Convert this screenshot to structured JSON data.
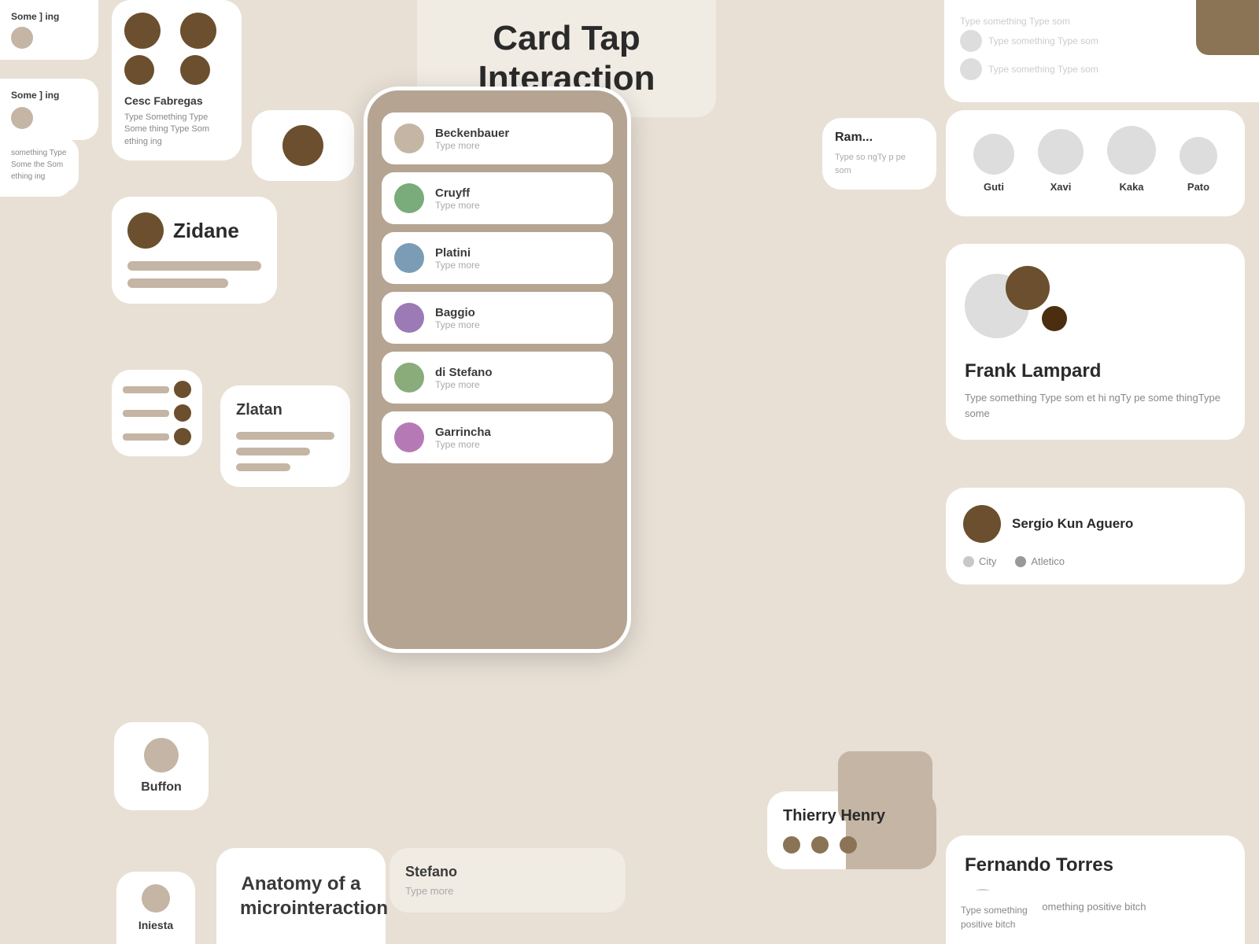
{
  "title": {
    "line1": "Card Tap",
    "line2": "Interaction"
  },
  "some_thing_1": "Some\n] ing",
  "some_thing_2": "Some\n] ing",
  "cesc": {
    "name": "Cesc Fabregas",
    "text": "Type Something Type Some thing Type Som ething ing"
  },
  "zidane": {
    "name": "Zidane"
  },
  "zlatan": {
    "name": "Zlatan"
  },
  "phone": {
    "players": [
      {
        "name": "Beckenbauer",
        "sub": "Type more",
        "color": "#c4b5a5"
      },
      {
        "name": "Cruyff",
        "sub": "Type more",
        "color": "#7aab7a"
      },
      {
        "name": "Platini",
        "sub": "Type more",
        "color": "#7a9db5"
      },
      {
        "name": "Baggio",
        "sub": "Type more",
        "color": "#9b7ab5"
      },
      {
        "name": "di Stefano",
        "sub": "Type more",
        "color": "#8aab7a"
      },
      {
        "name": "Garrincha",
        "sub": "Type more",
        "color": "#b57ab5"
      }
    ]
  },
  "stefano": {
    "name": "Stefano",
    "sub": "Type more"
  },
  "top_right": {
    "text1": "Type something Type som",
    "text2": "Type something Type som",
    "text3": "Type something Type som",
    "text4": "Type something Type som"
  },
  "players_row": {
    "players": [
      {
        "name": "Guti",
        "size": 52
      },
      {
        "name": "Xavi",
        "size": 58
      },
      {
        "name": "Kaka",
        "size": 62
      },
      {
        "name": "Pato",
        "size": 48
      }
    ]
  },
  "lampard": {
    "name": "Frank Lampard",
    "text": "Type something Type som et hi ngTy pe some thingType some"
  },
  "aguero": {
    "name": "Sergio Kun Aguero",
    "tag1": "City",
    "tag2": "Atletico"
  },
  "torres": {
    "name": "Fernando Torres",
    "text": "Type something positive bitch"
  },
  "ramos": {
    "name": "Ram...",
    "text": "Type so ngTy p pe som"
  },
  "henry": {
    "name": "Thierry Henry"
  },
  "buffon": {
    "name": "Buffon"
  },
  "iniesta": {
    "name": "Iniesta"
  },
  "anatomy": {
    "title": "Anatomy of a microinteraction"
  },
  "positive_bitch": {
    "text": "Type something positive bitch"
  },
  "left_text": {
    "text": "something Type Some the Som ething ing"
  }
}
